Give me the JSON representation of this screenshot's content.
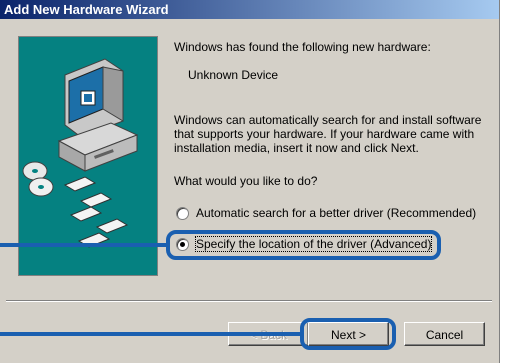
{
  "window": {
    "title": "Add New Hardware Wizard"
  },
  "content": {
    "found_text": "Windows has found the following new hardware:",
    "device_name": "Unknown Device",
    "description_lines": [
      "Windows can automatically search for and install software",
      "that supports your hardware. If your hardware came with",
      "installation media, insert it now and click Next."
    ],
    "question": "What would you like to do?",
    "options": [
      {
        "label": "Automatic search for a better driver (Recommended)",
        "selected": false
      },
      {
        "label": "Specify the location of the driver (Advanced)",
        "selected": true
      }
    ]
  },
  "buttons": {
    "back": "< Back",
    "next": "Next >",
    "cancel": "Cancel"
  },
  "colors": {
    "highlight": "#1a5fb0",
    "panel": "#058181",
    "title_bar": "#0a246a"
  }
}
